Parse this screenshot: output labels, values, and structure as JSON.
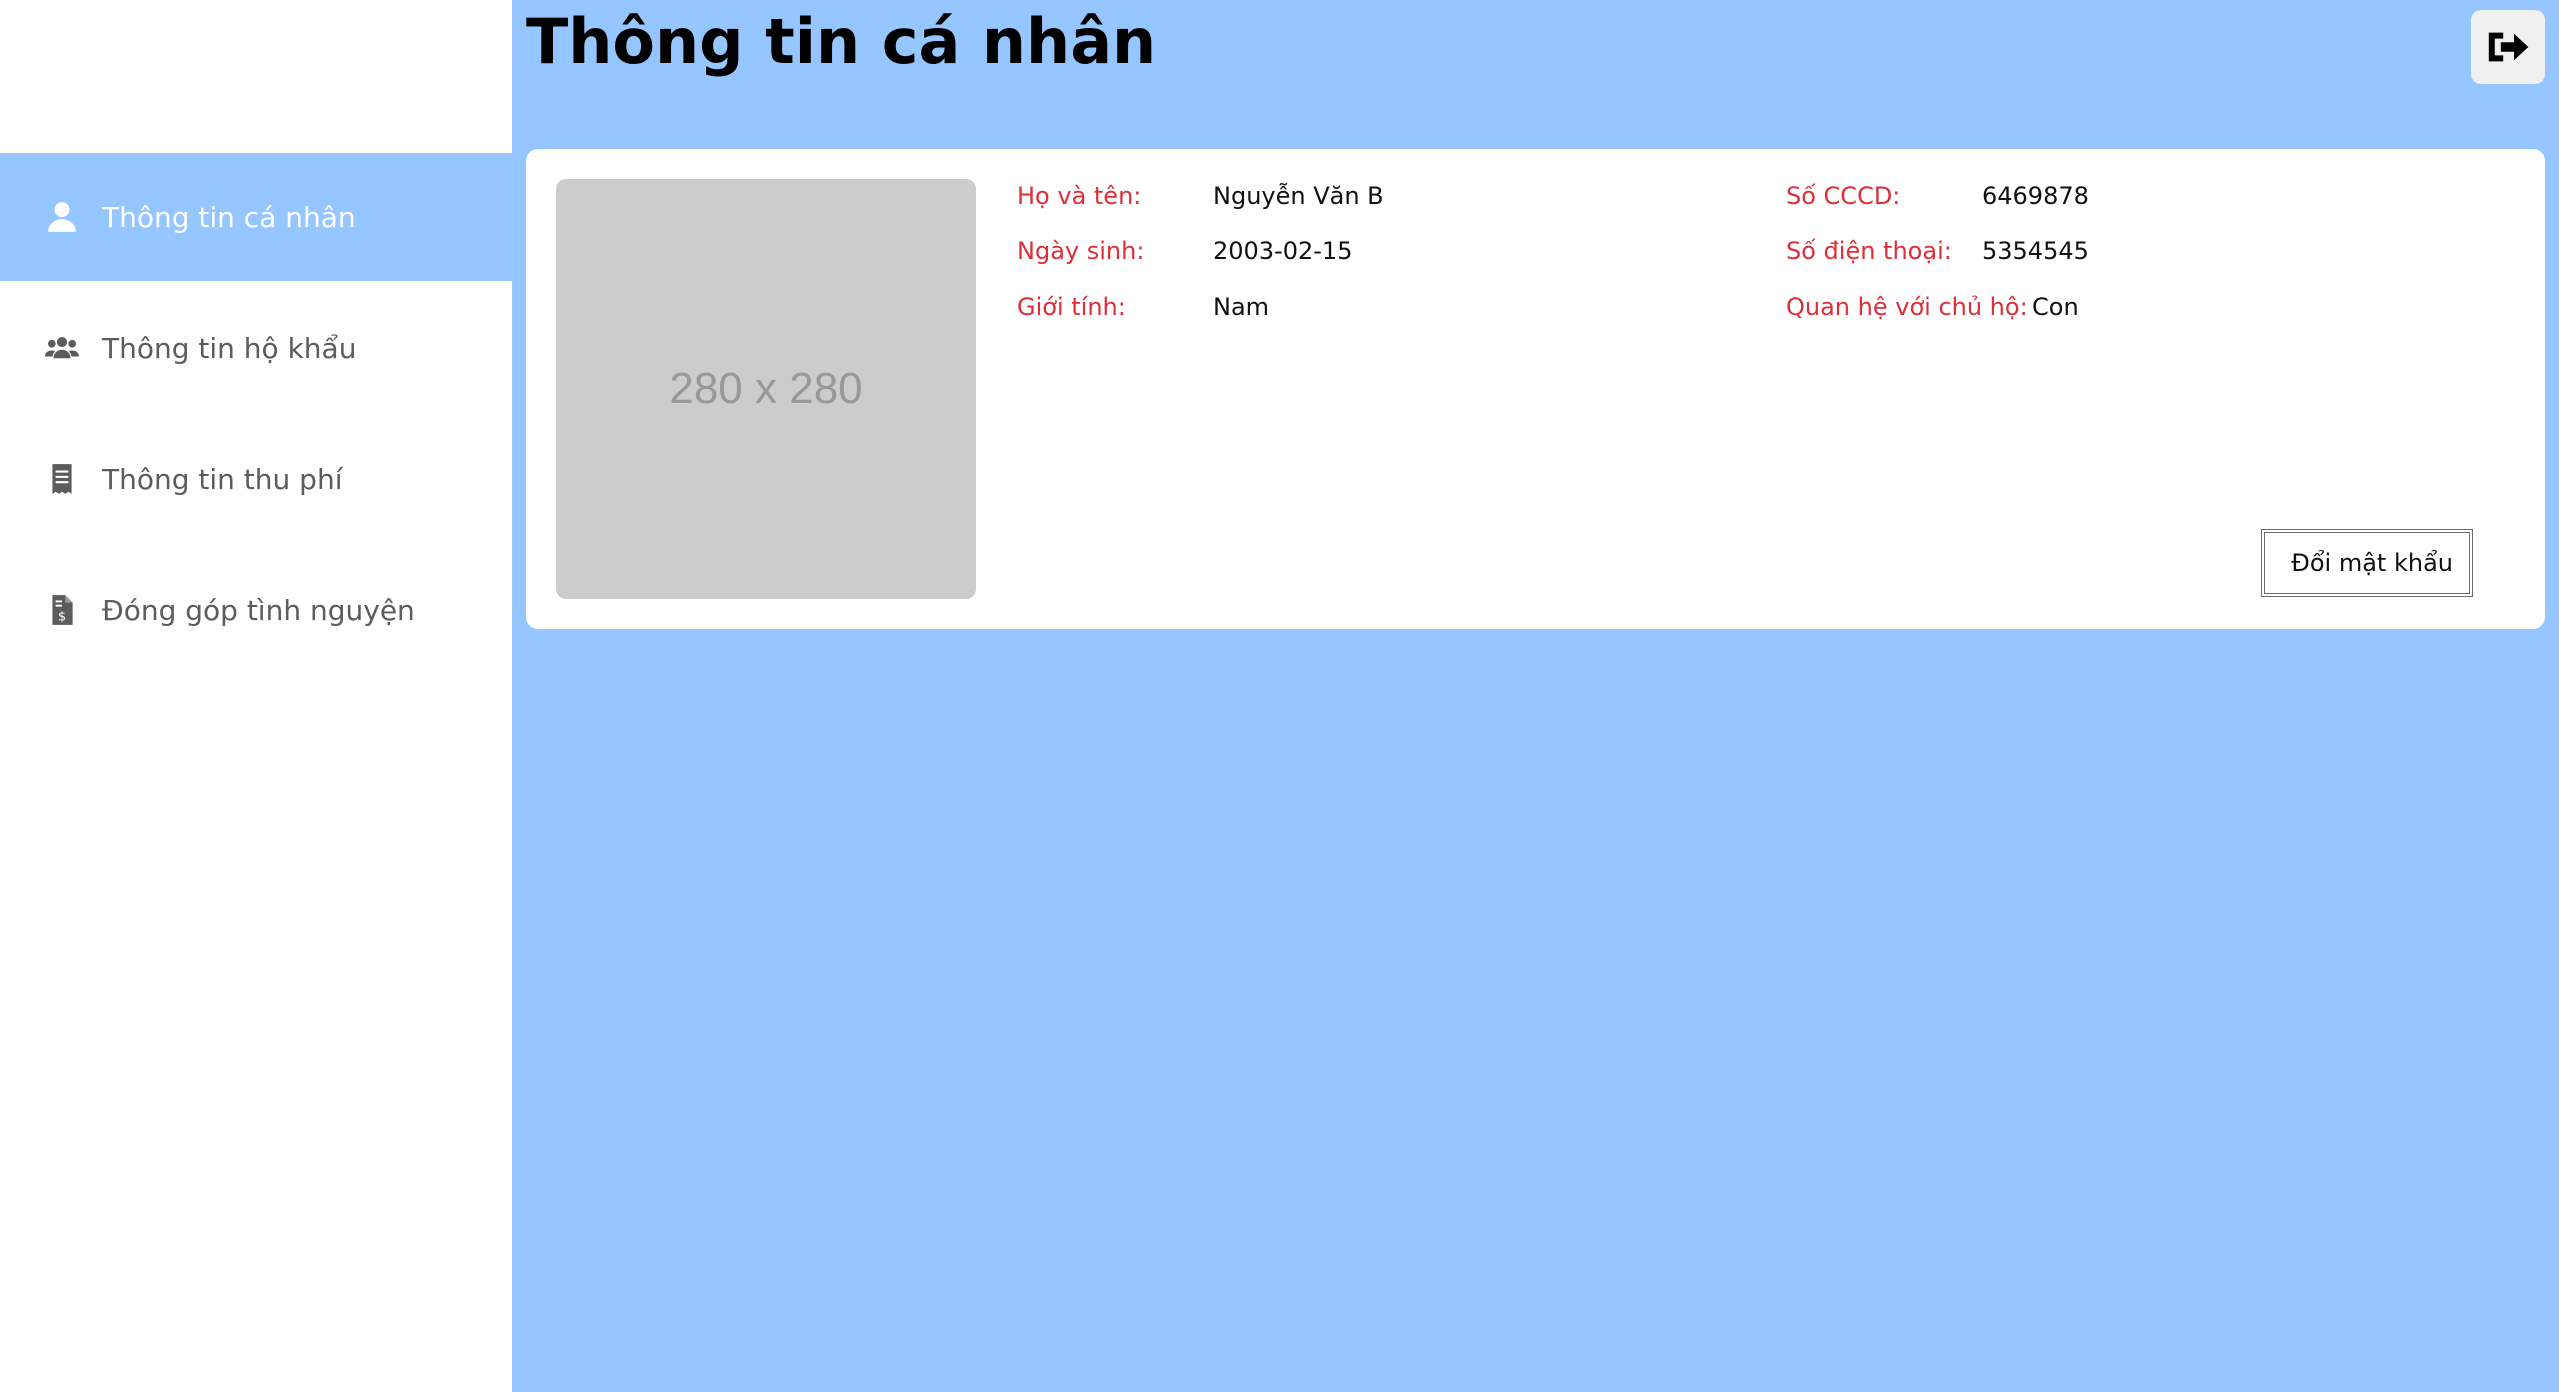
{
  "sidebar": {
    "items": [
      {
        "label": "Thông tin cá nhân",
        "icon": "user-icon",
        "active": true
      },
      {
        "label": "Thông tin hộ khẩu",
        "icon": "users-icon",
        "active": false
      },
      {
        "label": "Thông tin thu phí",
        "icon": "receipt-icon",
        "active": false
      },
      {
        "label": "Đóng góp tình nguyện",
        "icon": "file-invoice-dollar-icon",
        "active": false
      }
    ]
  },
  "header": {
    "title": "Thông tin cá nhân",
    "logout_icon": "sign-out-icon"
  },
  "profile": {
    "avatar_placeholder": "280 x 280",
    "full_name": {
      "label": "Họ và tên:",
      "value": "Nguyễn Văn B"
    },
    "birthdate": {
      "label": "Ngày sinh:",
      "value": "2003-02-15"
    },
    "gender": {
      "label": "Giới tính:",
      "value": "Nam"
    },
    "id_number": {
      "label": "Số CCCD:",
      "value": "6469878"
    },
    "phone": {
      "label": "Số điện thoại:",
      "value": "5354545"
    },
    "relation": {
      "label": "Quan hệ với chủ hộ:",
      "value": "Con"
    },
    "change_password_label": "Đổi mật khẩu"
  },
  "colors": {
    "accent": "#96c6ff",
    "label_red": "#dc2f3a",
    "sidebar_text": "#5c5c5c"
  }
}
